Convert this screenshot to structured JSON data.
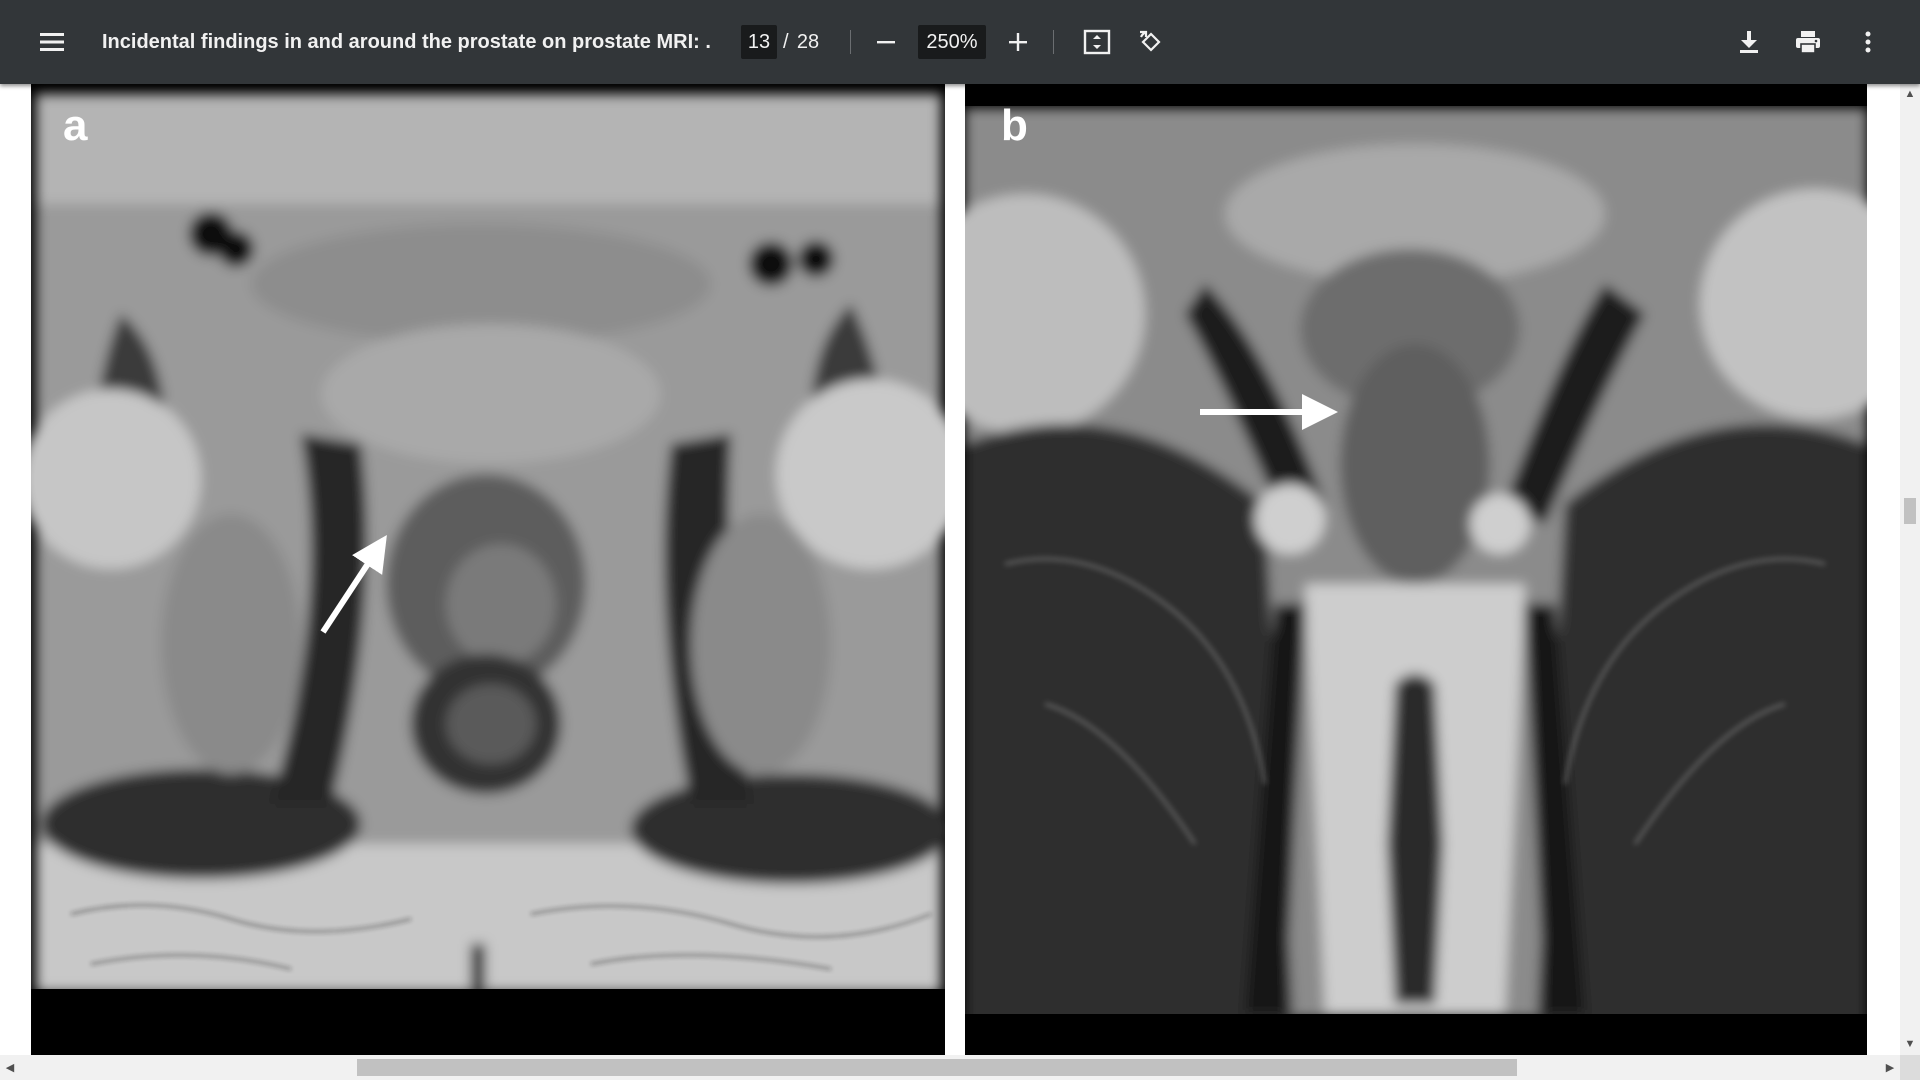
{
  "toolbar": {
    "title": "Incidental findings in and around the prostate on prostate MRI: ...",
    "current_page": "13",
    "page_separator": "/",
    "total_pages": "28",
    "zoom": "250%",
    "icons": {
      "menu": "hamburger-menu-icon",
      "zoom_out": "minus-icon",
      "zoom_in": "plus-icon",
      "fit": "fit-to-page-icon",
      "rotate": "rotate-counterclockwise-icon",
      "download": "download-icon",
      "print": "print-icon",
      "more": "more-vertical-icon"
    }
  },
  "figure": {
    "panels": [
      {
        "label": "a",
        "description_icon": "axial-mri-image"
      },
      {
        "label": "b",
        "description_icon": "coronal-mri-image"
      }
    ]
  },
  "colors": {
    "toolbar_bg": "#323639",
    "toolbar_text": "#f1f1f1",
    "input_bg": "#191b1c",
    "scrollbar_track": "#f1f1f1",
    "scrollbar_thumb": "#c1c1c1"
  }
}
